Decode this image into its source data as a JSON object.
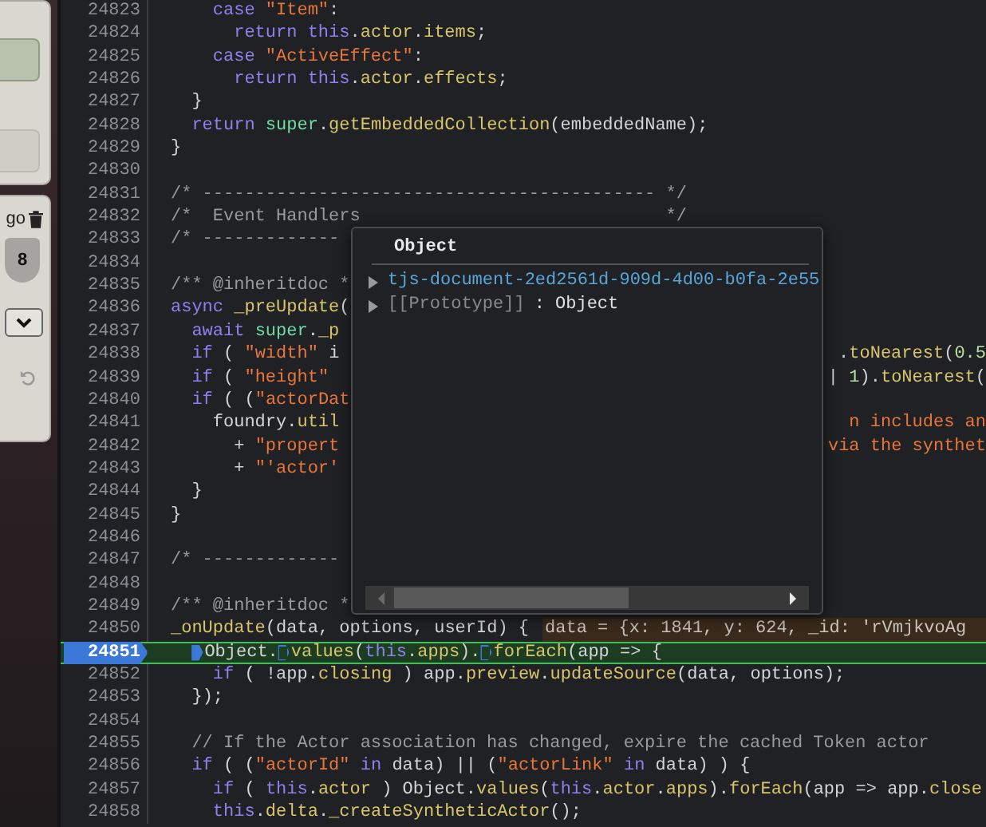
{
  "side_panel": {
    "label": "go",
    "shield_value": "8"
  },
  "editor": {
    "lines": [
      {
        "number": "24823",
        "text": "    case \"Item\":"
      },
      {
        "number": "24824",
        "text": "      return this.actor.items;"
      },
      {
        "number": "24825",
        "text": "    case \"ActiveEffect\":"
      },
      {
        "number": "24826",
        "text": "      return this.actor.effects;"
      },
      {
        "number": "24827",
        "text": "  }"
      },
      {
        "number": "24828",
        "text": "  return super.getEmbeddedCollection(embeddedName);"
      },
      {
        "number": "24829",
        "text": "}"
      },
      {
        "number": "24830"
      },
      {
        "number": "24831",
        "text": "/* ------------------------------------------- */"
      },
      {
        "number": "24832",
        "text": "/*  Event Handlers                             */"
      },
      {
        "number": "24833",
        "text": "/* -------------"
      },
      {
        "number": "24834"
      },
      {
        "number": "24835",
        "text": "/** @inheritdoc *"
      },
      {
        "number": "24836",
        "text": "async _preUpdate("
      },
      {
        "number": "24837",
        "text": "  await super._p"
      },
      {
        "number": "24838",
        "text": "  if ( \"width\" i",
        "tail": ".toNearest(0.5",
        "tail_in_string": false
      },
      {
        "number": "24839",
        "text": "  if ( \"height\"",
        "tail": "| 1).toNearest(",
        "tail_in_string": false
      },
      {
        "number": "24840",
        "text": "  if ( (\"actorDat"
      },
      {
        "number": "24841",
        "text": "    foundry.util",
        "tail": "n includes an",
        "tail_in_string": true
      },
      {
        "number": "24842",
        "text": "      + \"propert",
        "tail": "via the synthet",
        "tail_in_string": true
      },
      {
        "number": "24843",
        "text": "      + \"'actor'"
      },
      {
        "number": "24844",
        "text": "  }"
      },
      {
        "number": "24845",
        "text": "}"
      },
      {
        "number": "24846"
      },
      {
        "number": "24847",
        "text": "/* -------------"
      },
      {
        "number": "24848"
      },
      {
        "number": "24849",
        "text": "/** @inheritdoc *"
      },
      {
        "number": "24850",
        "text": "_onUpdate(data, options, userId) {",
        "inline_value": "data = {x: 1841, y: 624, _id: 'rVmjkvoAg"
      },
      {
        "number": "24851",
        "current": true,
        "segments": [
          {
            "text": "Object.",
            "active": true
          },
          {
            "text": "values(this.apps).",
            "active": false
          },
          {
            "text": "forEach(app => {",
            "active": false
          }
        ]
      },
      {
        "number": "24852",
        "text": "    if ( !app.closing ) app.preview.updateSource(data, options);"
      },
      {
        "number": "24853",
        "text": "  });"
      },
      {
        "number": "24854"
      },
      {
        "number": "24855",
        "text": "  // If the Actor association has changed, expire the cached Token actor"
      },
      {
        "number": "24856",
        "text": "  if ( (\"actorId\" in data) || (\"actorLink\" in data) ) {"
      },
      {
        "number": "24857",
        "text": "    if ( this.actor ) Object.values(this.actor.apps).forEach(app => app.close"
      },
      {
        "number": "24858",
        "text": "    this.delta._createSyntheticActor();"
      }
    ]
  },
  "tooltip": {
    "title": "Object",
    "rows": [
      {
        "kind": "property",
        "key": "tjs-document-2ed2561d-909d-4d00-b0fa-2e55"
      },
      {
        "kind": "prototype",
        "key": "[[Prototype]]",
        "value": ": Object"
      }
    ]
  }
}
